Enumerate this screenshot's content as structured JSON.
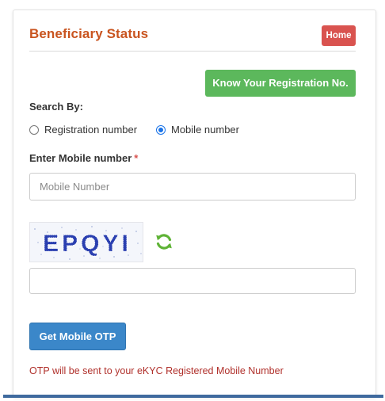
{
  "header": {
    "title": "Beneficiary Status",
    "home_label": "Home"
  },
  "know_registration_label": "Know Your Registration No.",
  "search_by": {
    "label": "Search By:",
    "options": [
      {
        "label": "Registration number",
        "selected": false
      },
      {
        "label": "Mobile number",
        "selected": true
      }
    ]
  },
  "mobile_field": {
    "label": "Enter Mobile number",
    "required_mark": "*",
    "placeholder": "Mobile Number",
    "value": ""
  },
  "captcha": {
    "text": "EPQYI",
    "refresh_icon": "refresh-icon",
    "input_value": ""
  },
  "otp_button_label": "Get Mobile OTP",
  "note": "OTP will be sent to your eKYC Registered Mobile Number",
  "colors": {
    "title": "#c9541f",
    "home_button": "#d9534f",
    "know_button": "#5cb85c",
    "otp_button": "#3b87c9",
    "note": "#b0302b",
    "radio_checked": "#1a73e8"
  }
}
